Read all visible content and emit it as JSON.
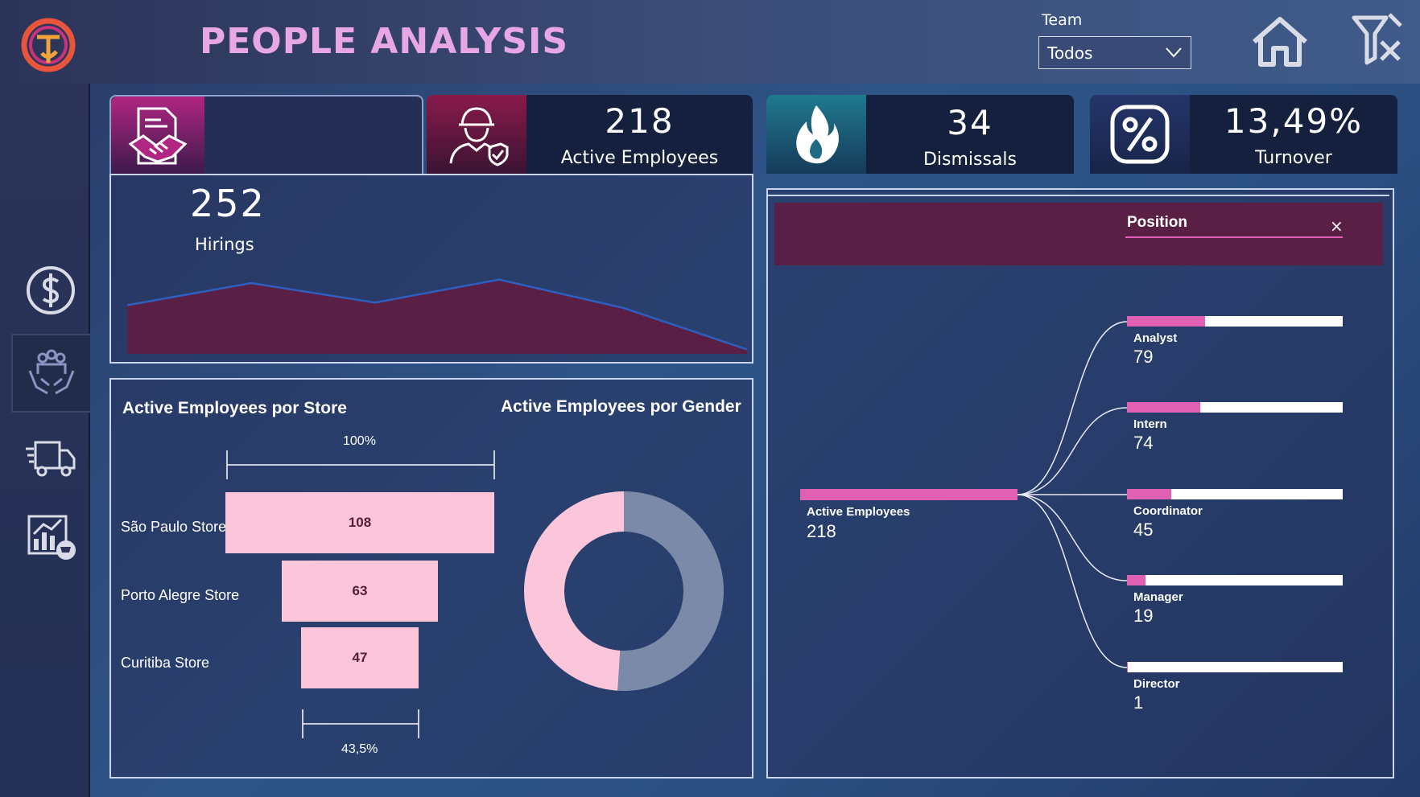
{
  "header": {
    "title": "PEOPLE ANALYSIS",
    "team_filter": {
      "label": "Team",
      "selected": "Todos"
    }
  },
  "icons": {
    "logo": "company-logo",
    "home": "home-icon",
    "filter": "clear-filter-icon",
    "nav": [
      "dollar-icon",
      "people-hands-icon",
      "delivery-truck-icon",
      "sales-chart-icon"
    ]
  },
  "kpis": {
    "hirings": {
      "value": "252",
      "label": "Hirings"
    },
    "active": {
      "value": "218",
      "label": "Active Employees"
    },
    "dismissals": {
      "value": "34",
      "label": "Dismissals"
    },
    "turnover": {
      "value": "13,49%",
      "label": "Turnover"
    }
  },
  "store_chart": {
    "title": "Active Employees por Store",
    "top_pct": "100%",
    "bottom_pct": "43,5%"
  },
  "gender_chart": {
    "title": "Active Employees por Gender"
  },
  "decomposition": {
    "position_tag": "Position",
    "close": "×",
    "root": {
      "label": "Active Employees",
      "value": "218"
    }
  },
  "chart_data": [
    {
      "type": "area",
      "title": "",
      "series": [
        {
          "values": [
            0.55,
            0.8,
            0.58,
            0.84,
            0.52,
            0.05
          ]
        }
      ]
    },
    {
      "type": "bar",
      "title": "Active Employees por Store",
      "categories": [
        "São Paulo Store",
        "Porto Alegre Store",
        "Curitiba Store"
      ],
      "values": [
        108,
        63,
        47
      ],
      "labels": [
        "108",
        "63",
        "47"
      ]
    },
    {
      "type": "pie",
      "title": "Active Employees por Gender",
      "values": [
        0.51,
        0.49
      ],
      "colors": [
        "#7a8aa8",
        "#fcc6da"
      ]
    },
    {
      "type": "bar",
      "title": "",
      "categories": [
        "Analyst",
        "Intern",
        "Coordinator",
        "Manager",
        "Director"
      ],
      "values": [
        79,
        74,
        45,
        19,
        1
      ],
      "labels": [
        "79",
        "74",
        "45",
        "19",
        "1"
      ]
    }
  ],
  "colors": {
    "accent_pink": "#e060b4",
    "bar_pink": "#fcc6da",
    "area_fill": "#5a1f44",
    "title": "#e7a6e4"
  }
}
